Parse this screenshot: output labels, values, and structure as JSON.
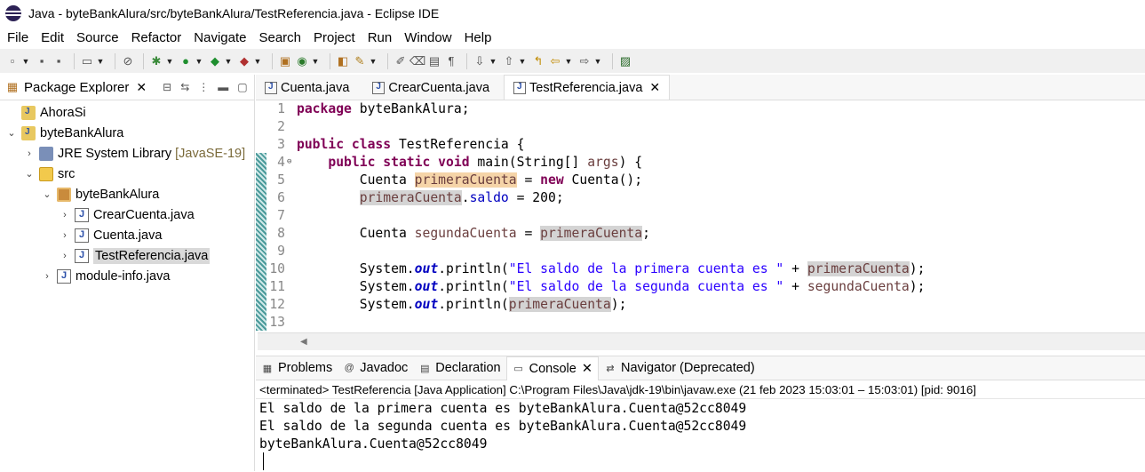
{
  "window": {
    "title": "Java - byteBankAlura/src/byteBankAlura/TestReferencia.java - Eclipse IDE"
  },
  "menu": [
    "File",
    "Edit",
    "Source",
    "Refactor",
    "Navigate",
    "Search",
    "Project",
    "Run",
    "Window",
    "Help"
  ],
  "package_explorer": {
    "title": "Package Explorer",
    "tree": [
      {
        "label": "AhoraSi"
      },
      {
        "label": "byteBankAlura"
      },
      {
        "label": "JRE System Library",
        "note": "[JavaSE-19]"
      },
      {
        "label": "src"
      },
      {
        "label": "byteBankAlura"
      },
      {
        "label": "CrearCuenta.java"
      },
      {
        "label": "Cuenta.java"
      },
      {
        "label": "TestReferencia.java"
      },
      {
        "label": "module-info.java"
      }
    ]
  },
  "editor": {
    "tabs": [
      "Cuenta.java",
      "CrearCuenta.java",
      "TestReferencia.java"
    ],
    "line_numbers": [
      "1",
      "2",
      "3",
      "4",
      "5",
      "6",
      "7",
      "8",
      "9",
      "10",
      "11",
      "12",
      "13"
    ],
    "code": {
      "l1_kw": "package",
      "l1_rest": " byteBankAlura;",
      "l3_kw": "public class",
      "l3_rest": " TestReferencia {",
      "l4_indent": "    ",
      "l4_kw": "public static void",
      "l4_mid": " main(String[] ",
      "l4_args": "args",
      "l4_end": ") {",
      "l5_indent": "        ",
      "l5_type": "Cuenta ",
      "l5_var": "primeraCuenta",
      "l5_eq": " = ",
      "l5_new": "new",
      "l5_end": " Cuenta();",
      "l6_indent": "        ",
      "l6_var": "primeraCuenta",
      "l6_dot": ".",
      "l6_fld": "saldo",
      "l6_end": " = 200;",
      "l8_indent": "        ",
      "l8_type": "Cuenta ",
      "l8_var": "segundaCuenta",
      "l8_eq": " = ",
      "l8_ref": "primeraCuenta",
      "l8_end": ";",
      "l10_indent": "        ",
      "l10_sys": "System.",
      "l10_out": "out",
      "l10_print": ".println(",
      "l10_str": "\"El saldo de la primera cuenta es \"",
      "l10_plus": " + ",
      "l10_var": "primeraCuenta",
      "l10_end": ");",
      "l11_indent": "        ",
      "l11_sys": "System.",
      "l11_out": "out",
      "l11_print": ".println(",
      "l11_str": "\"El saldo de la segunda cuenta es \"",
      "l11_plus": " + ",
      "l11_var": "segundaCuenta",
      "l11_end": ");",
      "l12_indent": "        ",
      "l12_sys": "System.",
      "l12_out": "out",
      "l12_print": ".println(",
      "l12_var": "primeraCuenta",
      "l12_end": ");"
    }
  },
  "console": {
    "tabs": [
      "Problems",
      "Javadoc",
      "Declaration",
      "Console",
      "Navigator (Deprecated)"
    ],
    "status": "<terminated> TestReferencia [Java Application] C:\\Program Files\\Java\\jdk-19\\bin\\javaw.exe  (21 feb 2023 15:03:01 – 15:03:01) [pid: 9016]",
    "output": [
      "El saldo de la primera cuenta es byteBankAlura.Cuenta@52cc8049",
      "El saldo de la segunda cuenta es byteBankAlura.Cuenta@52cc8049",
      "byteBankAlura.Cuenta@52cc8049"
    ]
  }
}
